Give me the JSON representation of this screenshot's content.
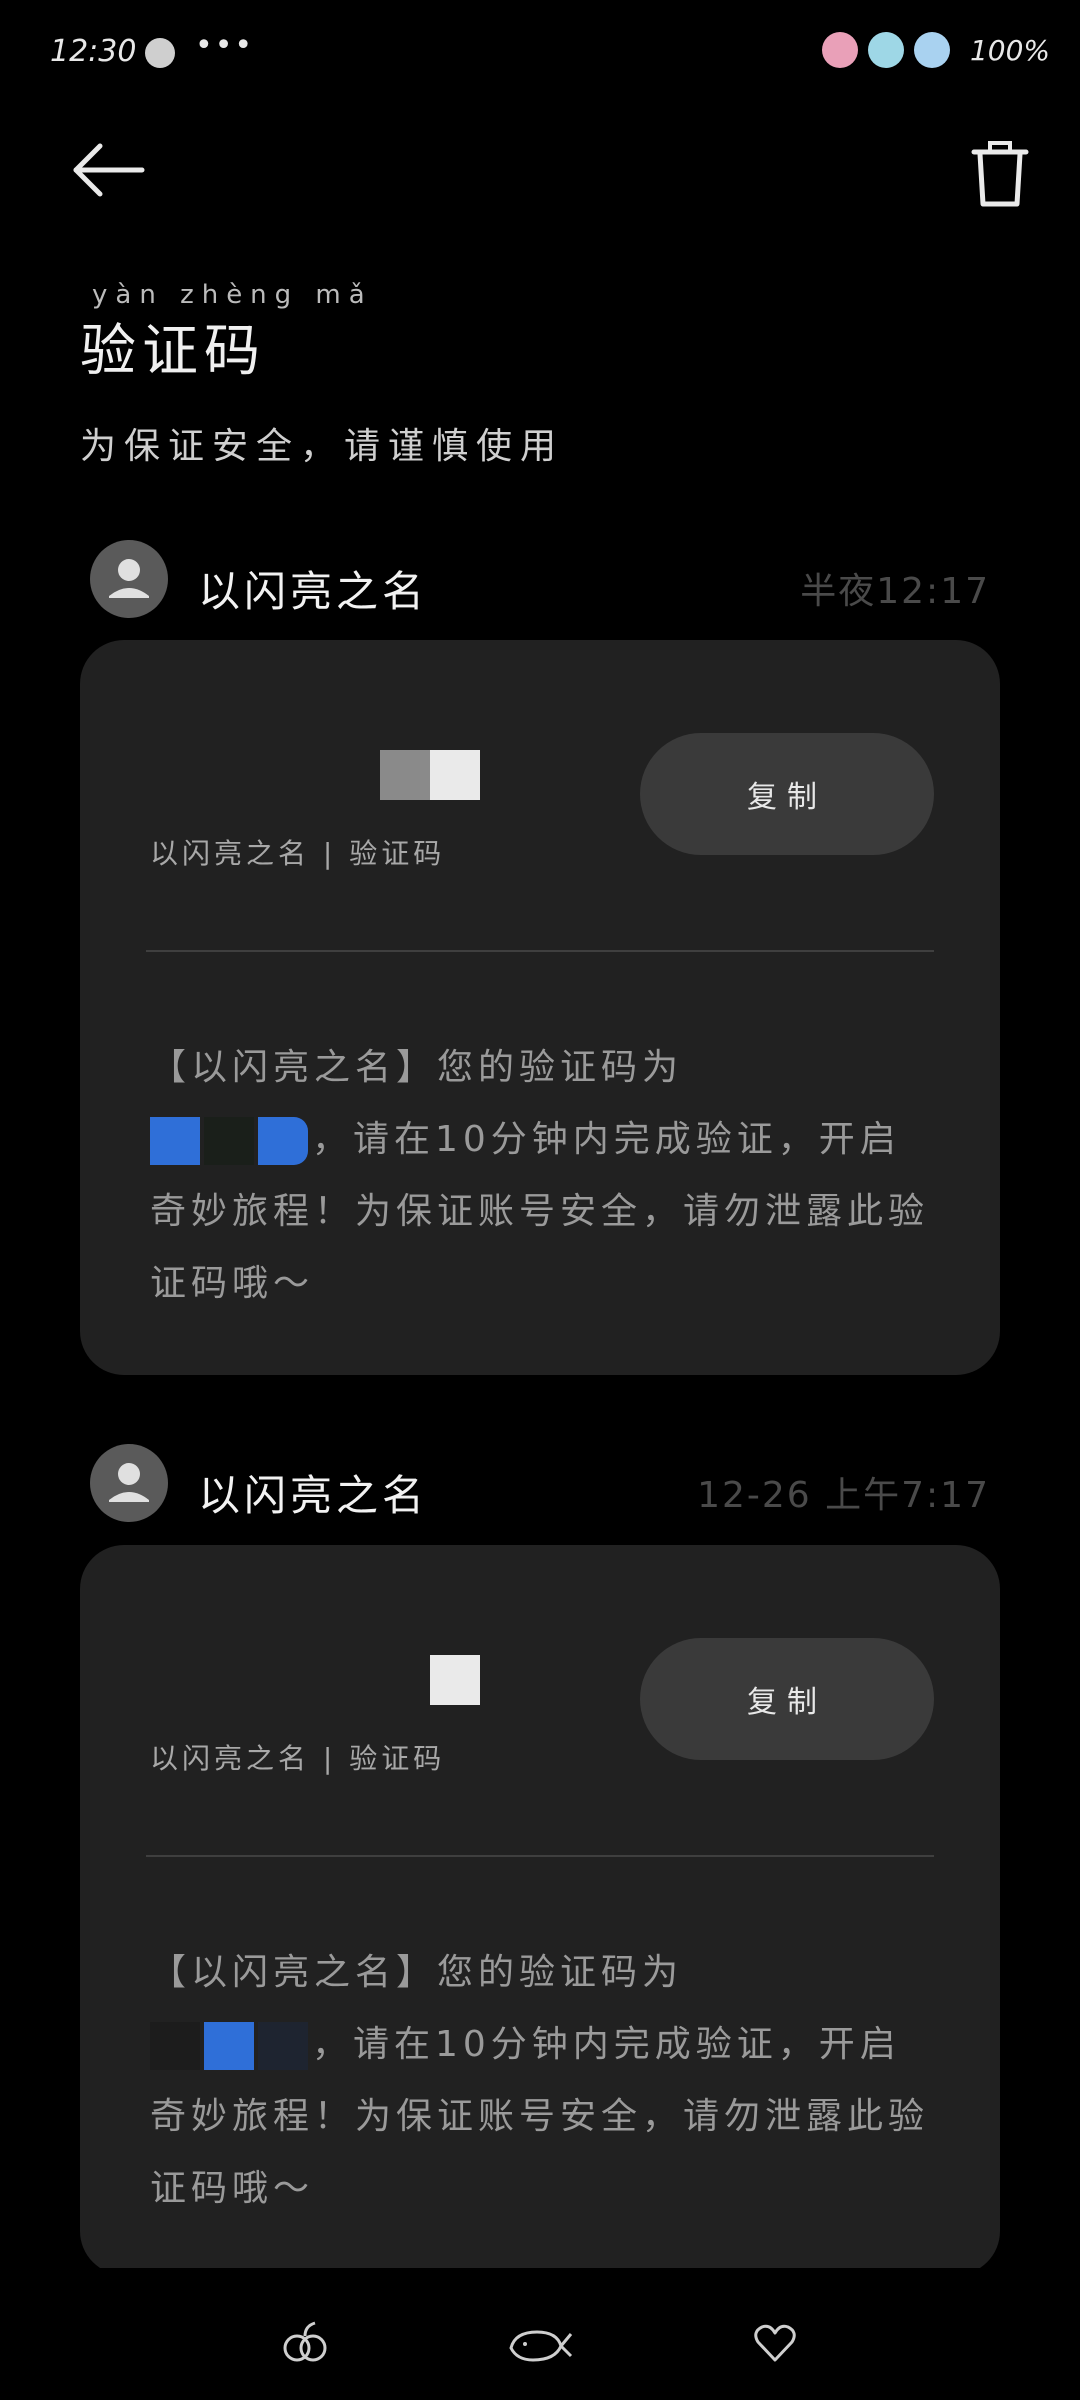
{
  "status_bar": {
    "time": "12:30",
    "more": "•••",
    "battery": "100%"
  },
  "header": {
    "title": "验证码",
    "title_pinyin": "yàn zhèng mǎ",
    "subtitle": "为保证安全，请谨慎使用"
  },
  "messages": [
    {
      "sender": "以闪亮之名",
      "timestamp": "半夜12:17",
      "code_source": "以闪亮之名 | 验证码",
      "copy_label": "复制",
      "body_prefix": "【以闪亮之名】您的验证码为",
      "body_rest": "，请在10分钟内完成验证，开启奇妙旅程！为保证账号安全，请勿泄露此验证码哦～"
    },
    {
      "sender": "以闪亮之名",
      "timestamp": "12-26 上午7:17",
      "code_source": "以闪亮之名 | 验证码",
      "copy_label": "复制",
      "body_prefix": "【以闪亮之名】您的验证码为",
      "body_rest": "，请在10分钟内完成验证，开启奇妙旅程！为保证账号安全，请勿泄露此验证码哦～"
    }
  ],
  "colors": {
    "background": "#000000",
    "card": "#212121",
    "button": "#3a3a3a",
    "redaction_blue": "#2f6fd8"
  }
}
